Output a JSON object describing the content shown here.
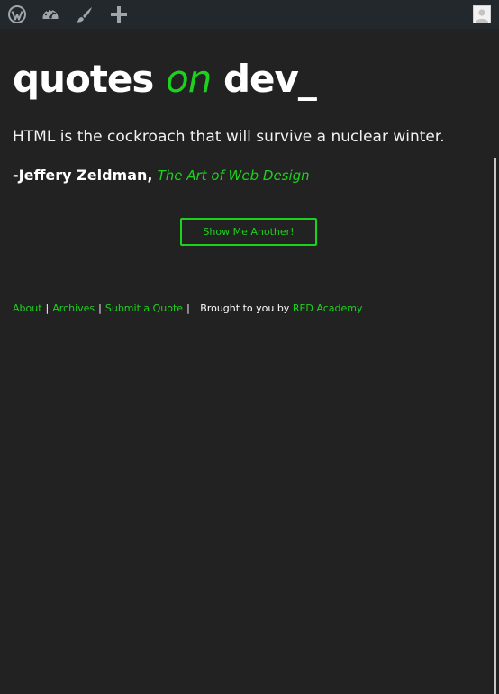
{
  "adminbar": {
    "icons": [
      "wordpress-icon",
      "dashboard-icon",
      "brush-icon",
      "plus-icon",
      "avatar"
    ],
    "background": "#23282d"
  },
  "site": {
    "title_part1": "quotes",
    "title_part2": "on",
    "title_part3": "dev_",
    "accent": "#1ed11e",
    "background": "#222222"
  },
  "quote": {
    "text": "HTML is the cockroach that will survive a nuclear winter.",
    "author": "-Jeffery Zeldman",
    "separator": ",",
    "source": "The Art of Web Design"
  },
  "button": {
    "label": "Show Me Another!"
  },
  "footer": {
    "links": [
      "About",
      "Archives",
      "Submit a Quote"
    ],
    "sep": "|",
    "brought_text": "Brought to you by",
    "brand_link": "RED Academy"
  }
}
